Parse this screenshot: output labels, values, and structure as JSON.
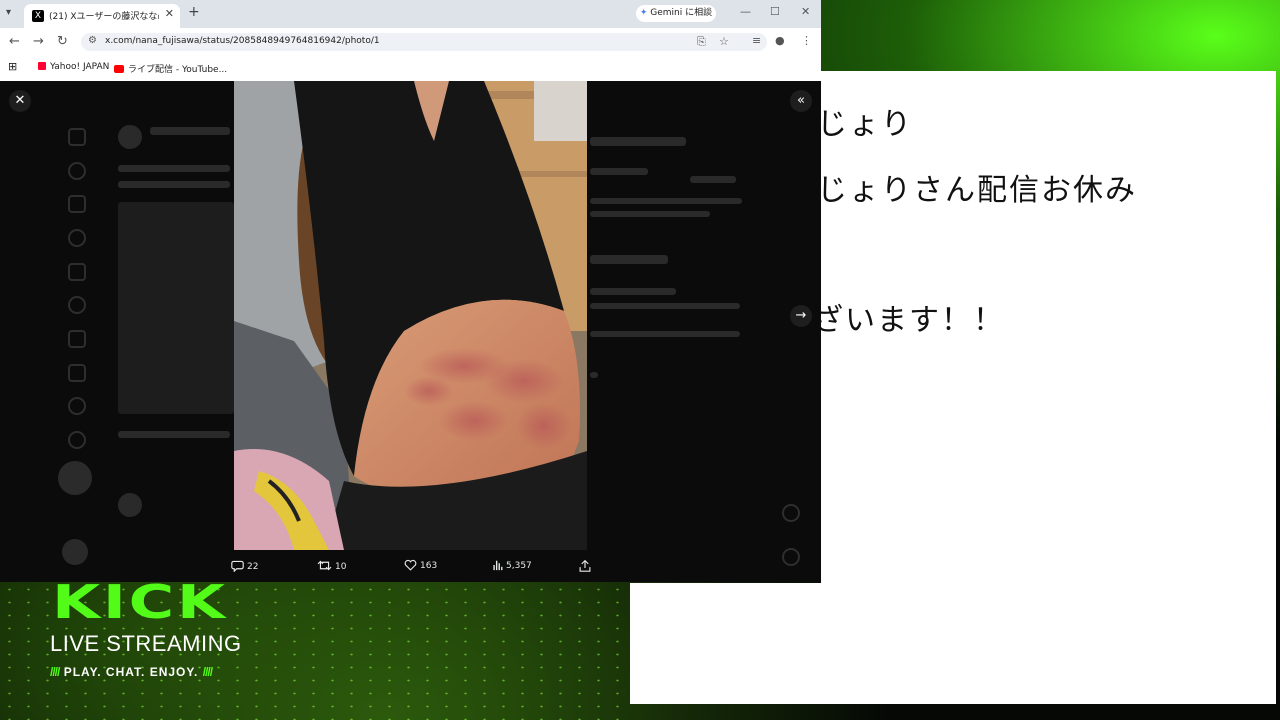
{
  "browser": {
    "tab_title": "(21) Xユーザーの藤沢なな@そんじ",
    "tab_favicon": "X",
    "new_tab_glyph": "+",
    "gemini_label": "Gemini に相談",
    "url": "x.com/nana_fujisawa/status/2085848949764816942/photo/1",
    "bookmarks": [
      {
        "label": "Yahoo! JAPAN",
        "icon": "yahoo-icon",
        "color": "#ff0033"
      },
      {
        "label": "ライブ配信 - YouTube...",
        "icon": "youtube-icon",
        "color": "#ff0000"
      }
    ]
  },
  "viewer": {
    "actions": {
      "replies": "22",
      "reposts": "10",
      "likes": "163",
      "views": "5,357"
    }
  },
  "notepad": {
    "lines": [
      "じょり",
      "じょりさん配信お休み",
      "ざいます！！"
    ]
  },
  "kick_banner": {
    "brand": "KICK",
    "live": "LIVE STREAMING",
    "slogan": "PLAY. CHAT. ENJOY.",
    "accent": "#53fc18"
  }
}
